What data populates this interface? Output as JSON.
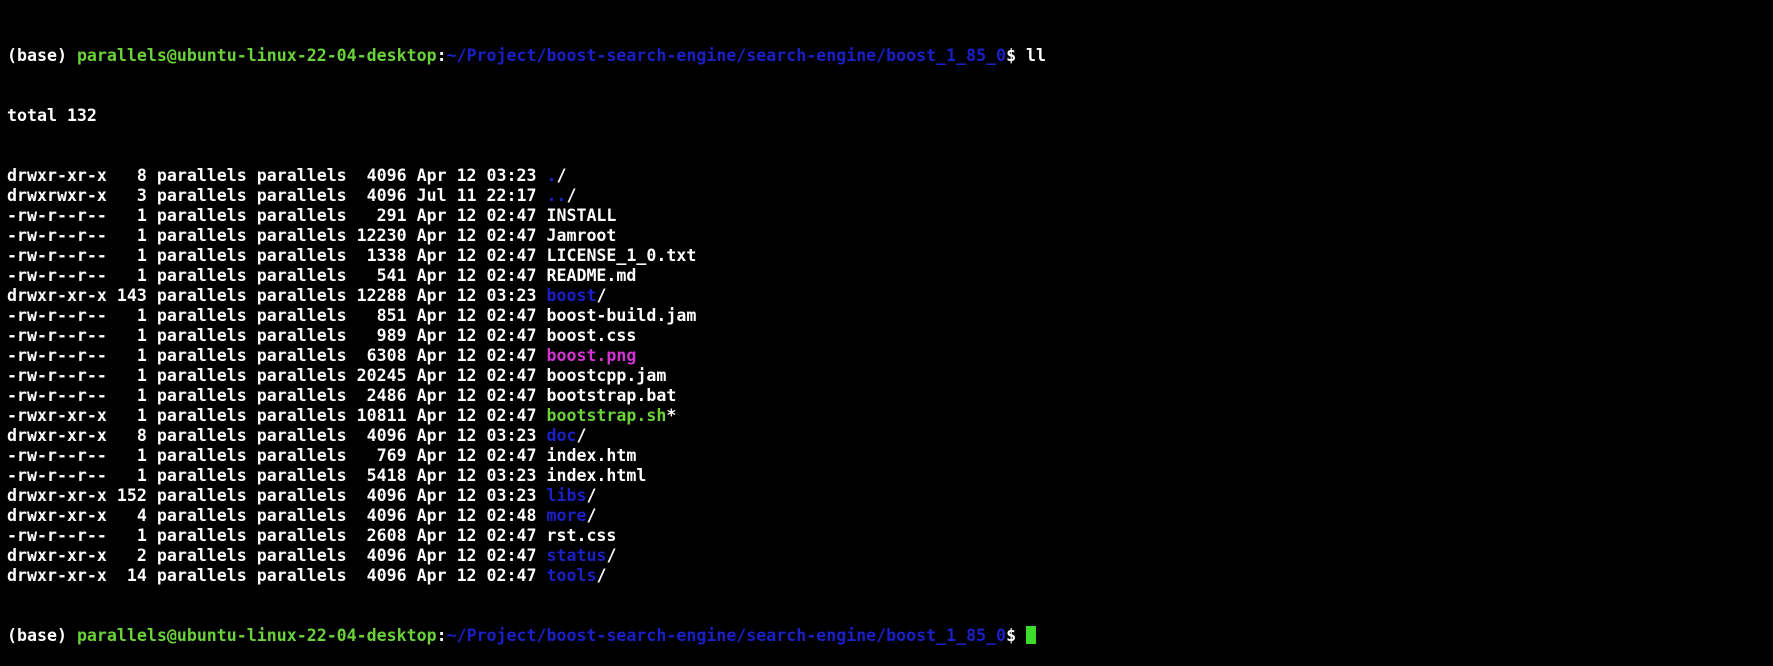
{
  "terminal": {
    "prompt": {
      "env": "(base) ",
      "user_host": "parallels@ubuntu-linux-22-04-desktop",
      "sep": ":",
      "path": "~/Project/boost-search-engine/search-engine/boost_1_85_0",
      "symbol": "$ "
    },
    "command": "ll",
    "total_line": "total 132",
    "entries": [
      {
        "meta": "drwxr-xr-x   8 parallels parallels  4096 Apr 12 03:23 ",
        "name": ".",
        "suffix": "/",
        "kind": "dir"
      },
      {
        "meta": "drwxrwxr-x   3 parallels parallels  4096 Jul 11 22:17 ",
        "name": "..",
        "suffix": "/",
        "kind": "dir"
      },
      {
        "meta": "-rw-r--r--   1 parallels parallels   291 Apr 12 02:47 ",
        "name": "INSTALL",
        "suffix": "",
        "kind": "file"
      },
      {
        "meta": "-rw-r--r--   1 parallels parallels 12230 Apr 12 02:47 ",
        "name": "Jamroot",
        "suffix": "",
        "kind": "file"
      },
      {
        "meta": "-rw-r--r--   1 parallels parallels  1338 Apr 12 02:47 ",
        "name": "LICENSE_1_0.txt",
        "suffix": "",
        "kind": "file"
      },
      {
        "meta": "-rw-r--r--   1 parallels parallels   541 Apr 12 02:47 ",
        "name": "README.md",
        "suffix": "",
        "kind": "file"
      },
      {
        "meta": "drwxr-xr-x 143 parallels parallels 12288 Apr 12 03:23 ",
        "name": "boost",
        "suffix": "/",
        "kind": "dir"
      },
      {
        "meta": "-rw-r--r--   1 parallels parallels   851 Apr 12 02:47 ",
        "name": "boost-build.jam",
        "suffix": "",
        "kind": "file"
      },
      {
        "meta": "-rw-r--r--   1 parallels parallels   989 Apr 12 02:47 ",
        "name": "boost.css",
        "suffix": "",
        "kind": "file"
      },
      {
        "meta": "-rw-r--r--   1 parallels parallels  6308 Apr 12 02:47 ",
        "name": "boost.png",
        "suffix": "",
        "kind": "img"
      },
      {
        "meta": "-rw-r--r--   1 parallels parallels 20245 Apr 12 02:47 ",
        "name": "boostcpp.jam",
        "suffix": "",
        "kind": "file"
      },
      {
        "meta": "-rw-r--r--   1 parallels parallels  2486 Apr 12 02:47 ",
        "name": "bootstrap.bat",
        "suffix": "",
        "kind": "file"
      },
      {
        "meta": "-rwxr-xr-x   1 parallels parallels 10811 Apr 12 02:47 ",
        "name": "bootstrap.sh",
        "suffix": "*",
        "kind": "exec"
      },
      {
        "meta": "drwxr-xr-x   8 parallels parallels  4096 Apr 12 03:23 ",
        "name": "doc",
        "suffix": "/",
        "kind": "dir"
      },
      {
        "meta": "-rw-r--r--   1 parallels parallels   769 Apr 12 02:47 ",
        "name": "index.htm",
        "suffix": "",
        "kind": "file"
      },
      {
        "meta": "-rw-r--r--   1 parallels parallels  5418 Apr 12 03:23 ",
        "name": "index.html",
        "suffix": "",
        "kind": "file"
      },
      {
        "meta": "drwxr-xr-x 152 parallels parallels  4096 Apr 12 03:23 ",
        "name": "libs",
        "suffix": "/",
        "kind": "dir"
      },
      {
        "meta": "drwxr-xr-x   4 parallels parallels  4096 Apr 12 02:48 ",
        "name": "more",
        "suffix": "/",
        "kind": "dir"
      },
      {
        "meta": "-rw-r--r--   1 parallels parallels  2608 Apr 12 02:47 ",
        "name": "rst.css",
        "suffix": "",
        "kind": "file"
      },
      {
        "meta": "drwxr-xr-x   2 parallels parallels  4096 Apr 12 02:47 ",
        "name": "status",
        "suffix": "/",
        "kind": "dir"
      },
      {
        "meta": "drwxr-xr-x  14 parallels parallels  4096 Apr 12 02:47 ",
        "name": "tools",
        "suffix": "/",
        "kind": "dir"
      }
    ],
    "colors": {
      "background": "#000000",
      "text": "#ffffff",
      "user_host": "#6ad33a",
      "path": "#1a1fc8",
      "directory": "#1a1fc8",
      "image": "#d233d2",
      "executable": "#6ad33a",
      "cursor": "#3ddc2b"
    },
    "cursor_icon": "block-cursor-icon"
  }
}
